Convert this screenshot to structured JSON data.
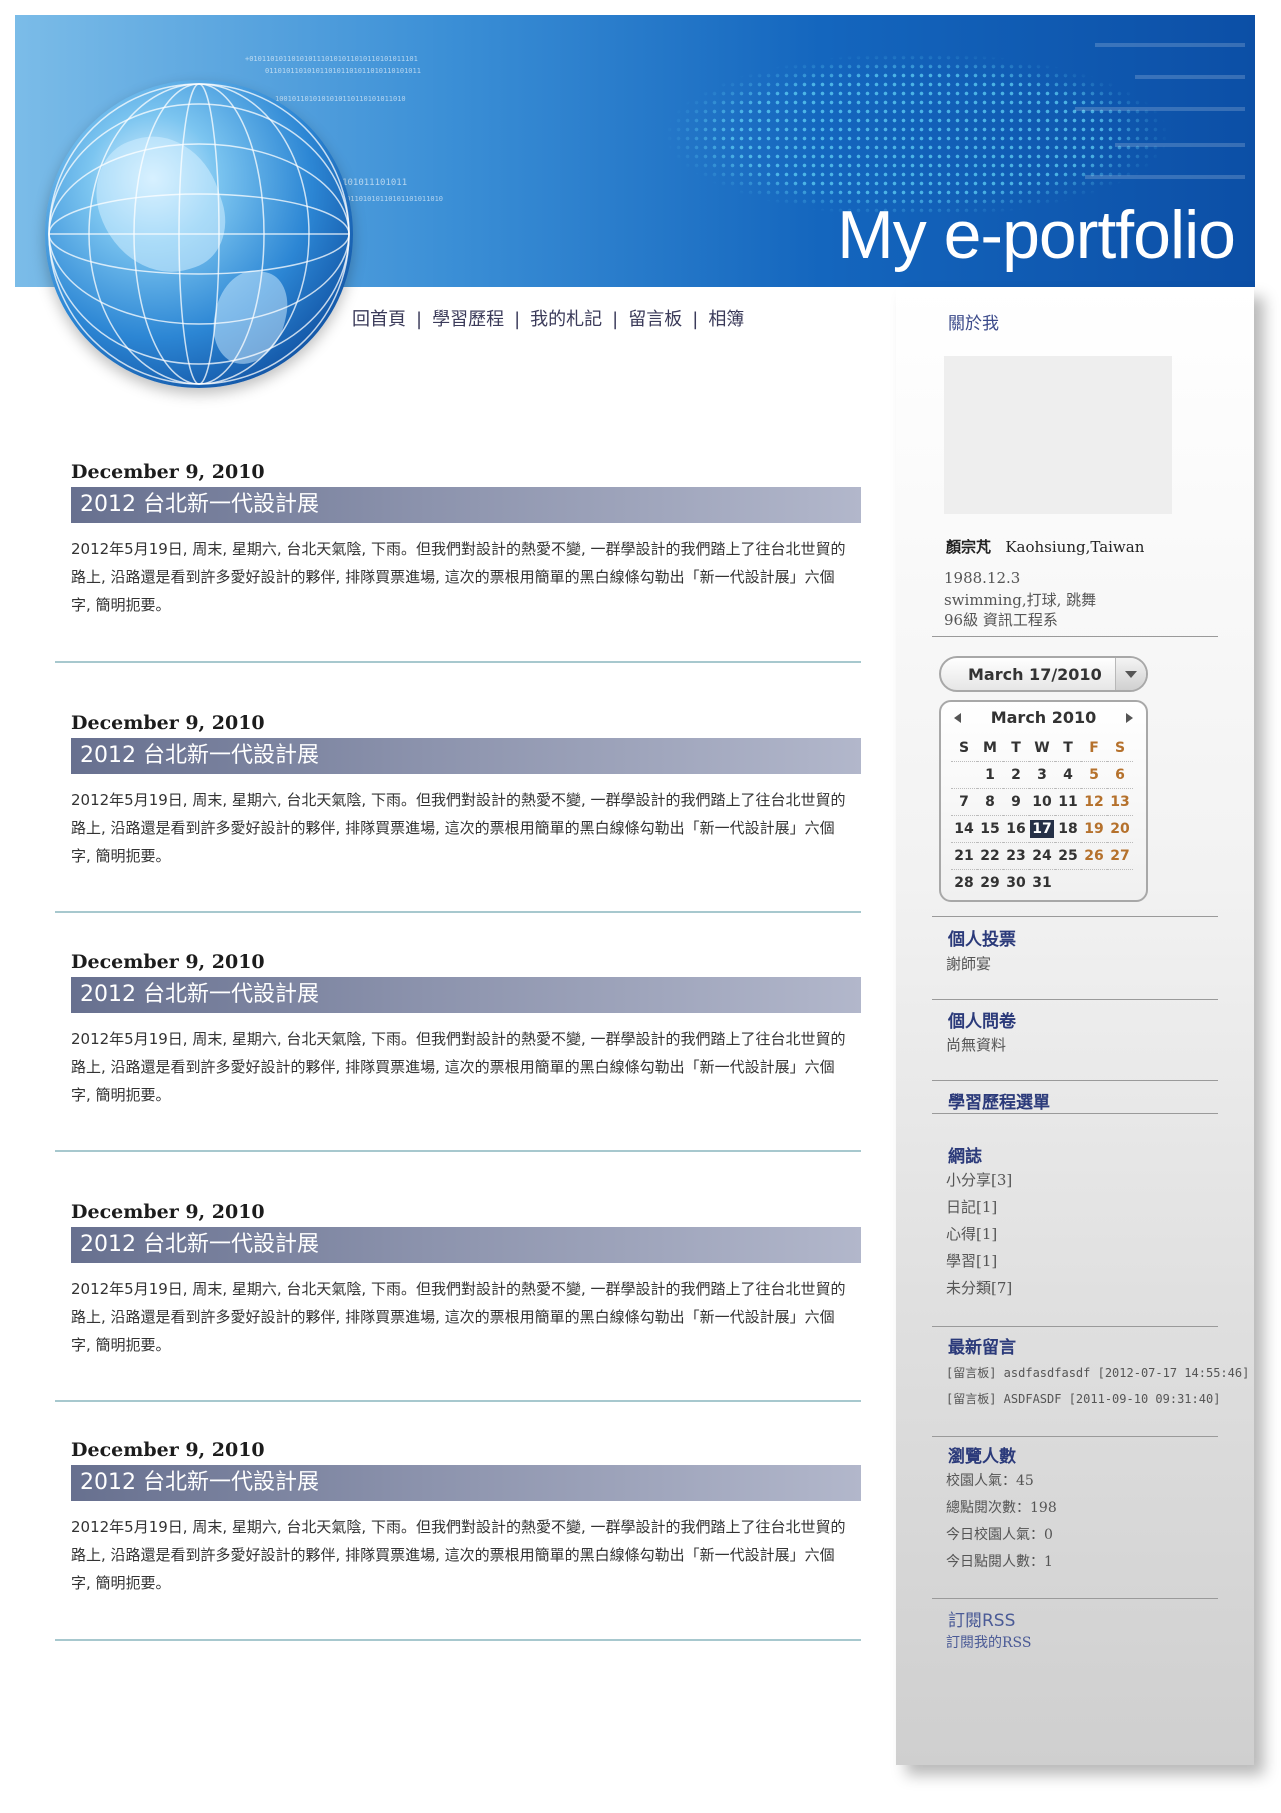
{
  "header": {
    "site_title": "My e-portfolio"
  },
  "nav": {
    "items": [
      "回首頁",
      "學習歷程",
      "我的札記",
      "留言板",
      "相簿"
    ],
    "separator": "|"
  },
  "posts": [
    {
      "date": "December 9, 2010",
      "title": "2012 台北新一代設計展",
      "body": "2012年5月19日, 周末, 星期六, 台北天氣陰, 下雨。但我們對設計的熱愛不變, 一群學設計的我們踏上了往台北世貿的路上, 沿路還是看到許多愛好設計的夥伴, 排隊買票進場, 這次的票根用簡單的黑白線條勾勒出「新一代設計展」六個字, 簡明扼要。"
    },
    {
      "date": "December 9, 2010",
      "title": "2012 台北新一代設計展",
      "body": "2012年5月19日, 周末, 星期六, 台北天氣陰, 下雨。但我們對設計的熱愛不變, 一群學設計的我們踏上了往台北世貿的路上, 沿路還是看到許多愛好設計的夥伴, 排隊買票進場, 這次的票根用簡單的黑白線條勾勒出「新一代設計展」六個字, 簡明扼要。"
    },
    {
      "date": "December 9, 2010",
      "title": "2012 台北新一代設計展",
      "body": "2012年5月19日, 周末, 星期六, 台北天氣陰, 下雨。但我們對設計的熱愛不變, 一群學設計的我們踏上了往台北世貿的路上, 沿路還是看到許多愛好設計的夥伴, 排隊買票進場, 這次的票根用簡單的黑白線條勾勒出「新一代設計展」六個字, 簡明扼要。"
    },
    {
      "date": "December 9, 2010",
      "title": "2012 台北新一代設計展",
      "body": "2012年5月19日, 周末, 星期六, 台北天氣陰, 下雨。但我們對設計的熱愛不變, 一群學設計的我們踏上了往台北世貿的路上, 沿路還是看到許多愛好設計的夥伴, 排隊買票進場, 這次的票根用簡單的黑白線條勾勒出「新一代設計展」六個字, 簡明扼要。"
    },
    {
      "date": "December 9, 2010",
      "title": "2012 台北新一代設計展",
      "body": "2012年5月19日, 周末, 星期六, 台北天氣陰, 下雨。但我們對設計的熱愛不變, 一群學設計的我們踏上了往台北世貿的路上, 沿路還是看到許多愛好設計的夥伴, 排隊買票進場, 這次的票根用簡單的黑白線條勾勒出「新一代設計展」六個字, 簡明扼要。"
    }
  ],
  "sidebar": {
    "about": {
      "heading": "關於我",
      "name": "顏宗芃",
      "location": "Kaohsiung,Taiwan",
      "birthday": "1988.12.3",
      "hobbies": "swimming,打球, 跳舞",
      "class": "96級 資訊工程系"
    },
    "date_picker": {
      "value": "March 17/2010",
      "month_label": "March 2010",
      "weekdays": [
        "S",
        "M",
        "T",
        "W",
        "T",
        "F",
        "S"
      ],
      "weeks": [
        [
          "",
          "1",
          "2",
          "3",
          "4",
          "5",
          "6"
        ],
        [
          "7",
          "8",
          "9",
          "10",
          "11",
          "12",
          "13"
        ],
        [
          "14",
          "15",
          "16",
          "17",
          "18",
          "19",
          "20"
        ],
        [
          "21",
          "22",
          "23",
          "24",
          "25",
          "26",
          "27"
        ],
        [
          "28",
          "29",
          "30",
          "31",
          "",
          "",
          ""
        ]
      ],
      "selected_day": "17"
    },
    "vote": {
      "heading": "個人投票",
      "item": "謝師宴"
    },
    "survey": {
      "heading": "個人問卷",
      "item": "尚無資料"
    },
    "portfolio_menu": {
      "heading": "學習歷程選單"
    },
    "blog": {
      "heading": "網誌",
      "items": [
        "小分享[3]",
        "日記[1]",
        "心得[1]",
        "學習[1]",
        "未分類[7]"
      ]
    },
    "latest_comments": {
      "heading": "最新留言",
      "items": [
        "[留言板] asdfasdfasdf [2012-07-17 14:55:46]",
        "[留言板] ASDFASDF [2011-09-10 09:31:40]"
      ]
    },
    "visitors": {
      "heading": "瀏覽人數",
      "items": [
        "校園人氣：45",
        "總點閱次數：198",
        "今日校園人氣：0",
        "今日點閱人數：1"
      ]
    },
    "rss": {
      "heading": "訂閱RSS",
      "link": "訂閱我的RSS"
    }
  },
  "colors": {
    "banner_dark": "#0c4fa6",
    "title_bar": "#67708f",
    "sidebar_heading": "#2b3a7a",
    "weekend": "#b5712c",
    "rule": "#a7c8ce"
  }
}
